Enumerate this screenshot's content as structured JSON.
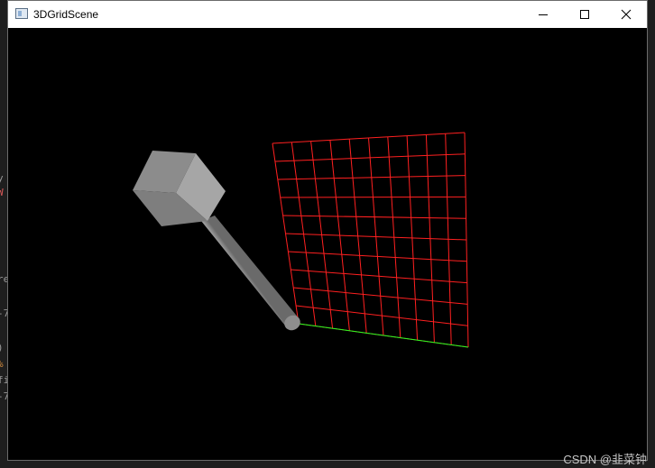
{
  "window": {
    "title": "3DGridScene",
    "minimize_icon": "minimize-icon",
    "maximize_icon": "maximize-icon",
    "close_icon": "close-icon"
  },
  "scene": {
    "grid_color": "#ff2020",
    "axis_color": "#20ff20",
    "background_color": "#000000",
    "object_color": "#9a9a9a"
  },
  "watermark": "CSDN @韭菜钟",
  "background_editor_fragments": [
    {
      "text": "y",
      "color": "#9a9a9a"
    },
    {
      "text": "W",
      "color": "#e05a5a"
    },
    {
      "text": "re",
      "color": "#9a9a9a"
    },
    {
      "text": "-7",
      "color": "#9a9a9a"
    },
    {
      "text": ")",
      "color": "#9a9a9a"
    },
    {
      "text": "%",
      "color": "#d08a3c"
    },
    {
      "text": "fi",
      "color": "#9a9a9a"
    },
    {
      "text": "-7",
      "color": "#9a9a9a"
    }
  ]
}
